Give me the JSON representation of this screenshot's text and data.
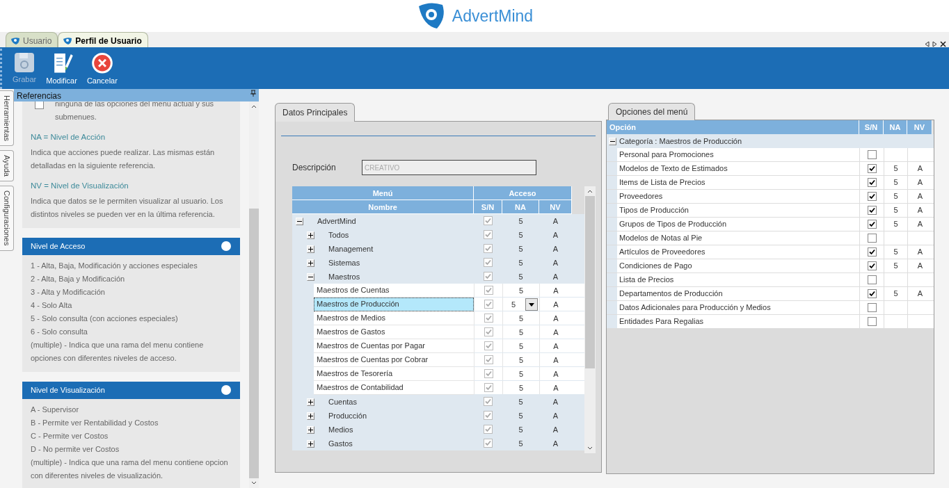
{
  "app": {
    "logo_text": "AdvertMind"
  },
  "doc_tabs": [
    {
      "label": "Usuario",
      "selected": false
    },
    {
      "label": "Perfil de Usuario",
      "selected": true
    }
  ],
  "toolbar": [
    {
      "label": "Grabar",
      "kind": "save",
      "disabled": true
    },
    {
      "label": "Modificar",
      "kind": "edit",
      "disabled": false
    },
    {
      "label": "Cancelar",
      "kind": "cancel",
      "disabled": false
    }
  ],
  "side_tabs": [
    "Herramientas",
    "Ayuda",
    "Configuraciones"
  ],
  "references": {
    "title": "Referencias",
    "intro_checked": false,
    "intro": "ninguna de las opciones del menu actual y sus submenues.",
    "sections": [
      {
        "heading": "NA = Nivel de Acción",
        "text": "Indica que acciones puede realizar. Las mismas están detalladas en la siguiente referencia."
      },
      {
        "heading": "NV = Nivel de Visualización",
        "text": "Indica que datos se le permiten visualizar al usuario. Los distintos niveles se pueden ver en la última referencia."
      }
    ],
    "cards": [
      {
        "title": "Nivel de Acceso",
        "items": [
          "1 - Alta, Baja, Modificación y acciones especiales",
          "2 - Alta, Baja y Modificación",
          "3 - Alta y Modificación",
          "4 - Solo Alta",
          "5 - Solo consulta (con acciones especiales)",
          "6 - Solo consulta",
          "(multiple) - Indica que una rama del menu contiene opciones con diferentes niveles de acceso."
        ]
      },
      {
        "title": "Nivel de Visualización",
        "items": [
          "A - Supervisor",
          "B - Permite ver Rentabilidad y Costos",
          "C - Permite ver Costos",
          "D - No permite ver Costos",
          "(multiple) - Indica que una rama del menu contiene opcion con diferentes niveles de visualización."
        ]
      }
    ]
  },
  "main": {
    "tab": "Datos Principales",
    "description_label": "Descripción",
    "description_value": "CREATIVO",
    "group_headers": [
      "Menú",
      "Acceso"
    ],
    "columns": [
      "Nombre",
      "S/N",
      "NA",
      "NV"
    ],
    "tree": [
      {
        "name": "AdvertMind",
        "sn": true,
        "na": "5",
        "nv": "A",
        "expanded": true,
        "selected": false,
        "children": [
          {
            "name": "Todos",
            "sn": true,
            "na": "5",
            "nv": "A",
            "expanded": false,
            "selected": false
          },
          {
            "name": "Management",
            "sn": true,
            "na": "5",
            "nv": "A",
            "expanded": false,
            "selected": false
          },
          {
            "name": "Sistemas",
            "sn": true,
            "na": "5",
            "nv": "A",
            "expanded": false,
            "selected": false
          },
          {
            "name": "Maestros",
            "sn": true,
            "na": "5",
            "nv": "A",
            "expanded": true,
            "selected": false,
            "children": [
              {
                "name": "Maestros de Cuentas",
                "sn": true,
                "na": "5",
                "nv": "A",
                "selected": false
              },
              {
                "name": "Maestros de Producción",
                "sn": true,
                "na": "5",
                "nv": "A",
                "selected": true
              },
              {
                "name": "Maestros de Medios",
                "sn": true,
                "na": "5",
                "nv": "A",
                "selected": false
              },
              {
                "name": "Maestros de Gastos",
                "sn": true,
                "na": "5",
                "nv": "A",
                "selected": false
              },
              {
                "name": "Maestros de Cuentas por Pagar",
                "sn": true,
                "na": "5",
                "nv": "A",
                "selected": false
              },
              {
                "name": "Maestros de Cuentas por Cobrar",
                "sn": true,
                "na": "5",
                "nv": "A",
                "selected": false
              },
              {
                "name": "Maestros de Tesorería",
                "sn": true,
                "na": "5",
                "nv": "A",
                "selected": false
              },
              {
                "name": "Maestros de Contabilidad",
                "sn": true,
                "na": "5",
                "nv": "A",
                "selected": false
              }
            ]
          },
          {
            "name": "Cuentas",
            "sn": true,
            "na": "5",
            "nv": "A",
            "expanded": false,
            "selected": false
          },
          {
            "name": "Producción",
            "sn": true,
            "na": "5",
            "nv": "A",
            "expanded": false,
            "selected": false
          },
          {
            "name": "Medios",
            "sn": true,
            "na": "5",
            "nv": "A",
            "expanded": false,
            "selected": false
          },
          {
            "name": "Gastos",
            "sn": true,
            "na": "5",
            "nv": "A",
            "expanded": false,
            "selected": false
          }
        ]
      }
    ]
  },
  "options": {
    "tab": "Opciones del menú",
    "columns": [
      "Opción",
      "S/N",
      "NA",
      "NV"
    ],
    "category": {
      "label": "Categoría : Maestros de Producción",
      "expanded": true
    },
    "rows": [
      {
        "name": "Personal para Promociones",
        "checked": false
      },
      {
        "name": "Modelos de Texto de Estimados",
        "checked": true,
        "na": "5",
        "nv": "A"
      },
      {
        "name": "Items de Lista de Precios",
        "checked": true,
        "na": "5",
        "nv": "A"
      },
      {
        "name": "Proveedores",
        "checked": true,
        "na": "5",
        "nv": "A"
      },
      {
        "name": "Tipos de Producción",
        "checked": true,
        "na": "5",
        "nv": "A"
      },
      {
        "name": "Grupos de Tipos de Producción",
        "checked": true,
        "na": "5",
        "nv": "A"
      },
      {
        "name": "Modelos de Notas al Pie",
        "checked": false
      },
      {
        "name": "Artículos de Proveedores",
        "checked": true,
        "na": "5",
        "nv": "A"
      },
      {
        "name": "Condiciones de Pago",
        "checked": true,
        "na": "5",
        "nv": "A"
      },
      {
        "name": "Lista de Precios",
        "checked": false
      },
      {
        "name": "Departamentos de Producción",
        "checked": true,
        "na": "5",
        "nv": "A"
      },
      {
        "name": "Datos Adicionales para Producción y Medios",
        "checked": false
      },
      {
        "name": "Entidades Para Regalias",
        "checked": false
      }
    ]
  }
}
